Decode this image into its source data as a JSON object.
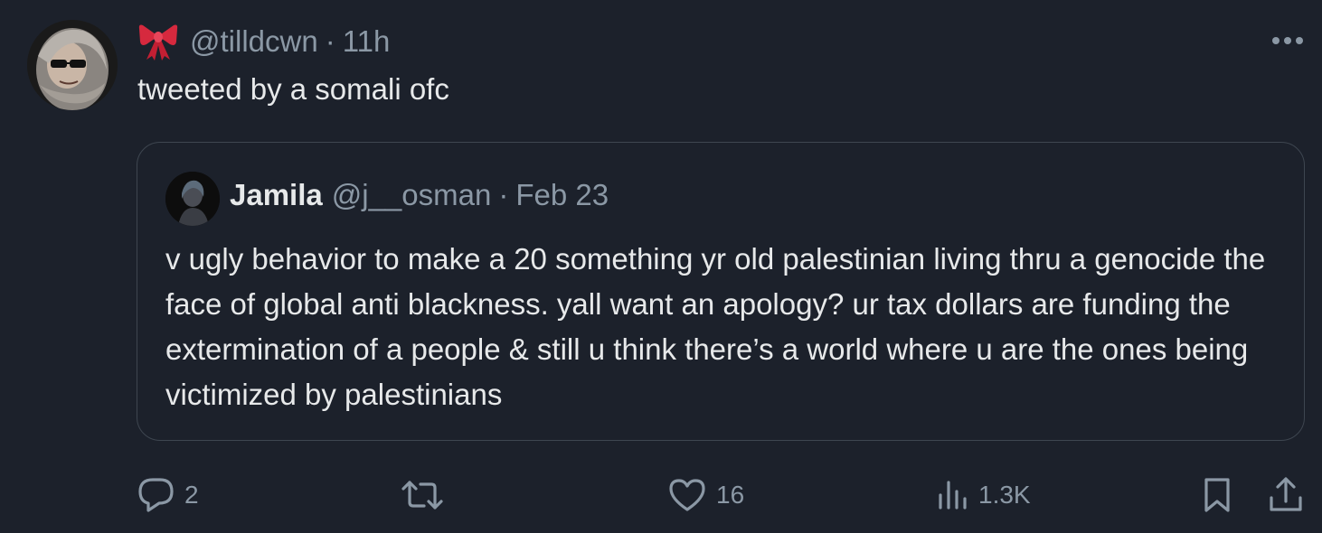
{
  "tweet": {
    "author_handle": "@tilldcwn",
    "separator": "·",
    "time": "11h",
    "text": "tweeted by a somali ofc",
    "author_badge_icon": "ribbon-bow-emoji",
    "more_icon": "more-dots-icon"
  },
  "quoted_tweet": {
    "name": "Jamila",
    "handle": "@j__osman",
    "separator": "·",
    "date": "Feb 23",
    "text": "v ugly behavior to make a 20 something yr old palestinian living thru a genocide the face of global anti blackness. yall want an apology? ur tax dollars are funding the extermination of a people & still u think there’s a world where u are the ones being victimized by palestinians"
  },
  "actions": {
    "reply": {
      "icon": "reply-icon",
      "count": "2"
    },
    "retweet": {
      "icon": "retweet-icon",
      "count": ""
    },
    "like": {
      "icon": "heart-icon",
      "count": "16"
    },
    "views": {
      "icon": "views-chart-icon",
      "count": "1.3K"
    },
    "bookmark": {
      "icon": "bookmark-icon"
    },
    "share": {
      "icon": "share-icon"
    }
  },
  "colors": {
    "background": "#1c212b",
    "text_primary": "#e7e9ea",
    "text_secondary": "#8b98a5",
    "border": "#3e4650",
    "bow_red": "#d6293e"
  }
}
